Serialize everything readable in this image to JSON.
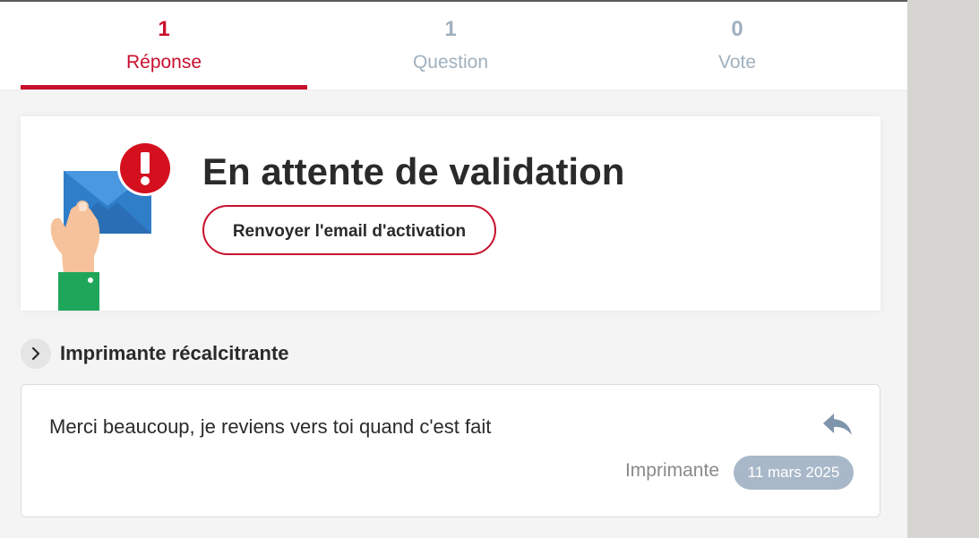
{
  "tabs": [
    {
      "count": "1",
      "label": "Réponse",
      "active": true
    },
    {
      "count": "1",
      "label": "Question",
      "active": false
    },
    {
      "count": "0",
      "label": "Vote",
      "active": false
    }
  ],
  "validation": {
    "title": "En attente de validation",
    "resend_button": "Renvoyer l'email d'activation",
    "illustration_icon": "envelope-alert-icon"
  },
  "thread": {
    "title": "Imprimante récalcitrante",
    "toggle_icon": "chevron-right-icon"
  },
  "message": {
    "text": "Merci beaucoup, je reviens vers toi quand c'est fait",
    "author": "Imprimante",
    "date": "11 mars 2025",
    "reply_icon": "reply-icon"
  },
  "colors": {
    "accent": "#c8102e",
    "inactive_tab": "#9fb0bf",
    "badge": "#a9b8c8",
    "text": "#2a2a2a"
  }
}
